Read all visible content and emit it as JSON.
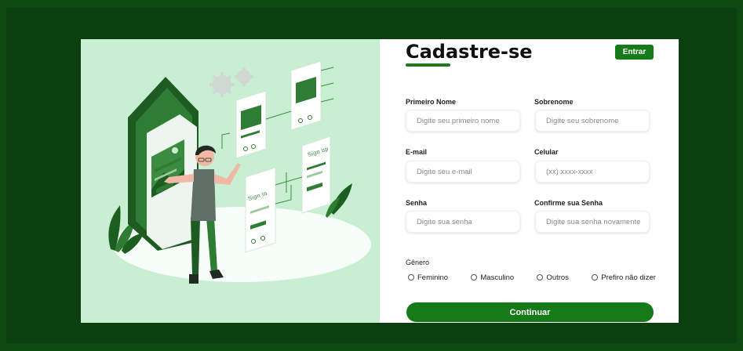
{
  "header": {
    "title": "Cadastre-se",
    "login_button": "Entrar"
  },
  "form": {
    "first_name": {
      "label": "Primeiro Nome",
      "placeholder": "Digite seu primeiro nome",
      "value": ""
    },
    "last_name": {
      "label": "Sobrenome",
      "placeholder": "Digite seu sobrenome",
      "value": ""
    },
    "email": {
      "label": "E-mail",
      "placeholder": "Digite seu e-mail",
      "value": ""
    },
    "phone": {
      "label": "Celular",
      "placeholder": "(xx) xxxx-xxxx",
      "value": ""
    },
    "password": {
      "label": "Senha",
      "placeholder": "Digite sua senha",
      "value": ""
    },
    "confirm_password": {
      "label": "Confirme sua Senha",
      "placeholder": "Digite sua senha novamente",
      "value": ""
    },
    "gender": {
      "label": "Gênero",
      "options": [
        "Feminino",
        "Masculino",
        "Outros",
        "Prefiro não dizer"
      ],
      "selected": null
    },
    "submit_button": "Continuar"
  },
  "illustration": {
    "sign_up_text": "Sign up",
    "sign_in_text": "Sign in"
  },
  "colors": {
    "page_background": "#0c4a12",
    "accent": "#177a19",
    "illustration_background": "#c8efd2",
    "card_background": "#ffffff"
  },
  "icons": [
    "gear-icon",
    "phone-illustration",
    "person-illustration",
    "plant-icon"
  ]
}
